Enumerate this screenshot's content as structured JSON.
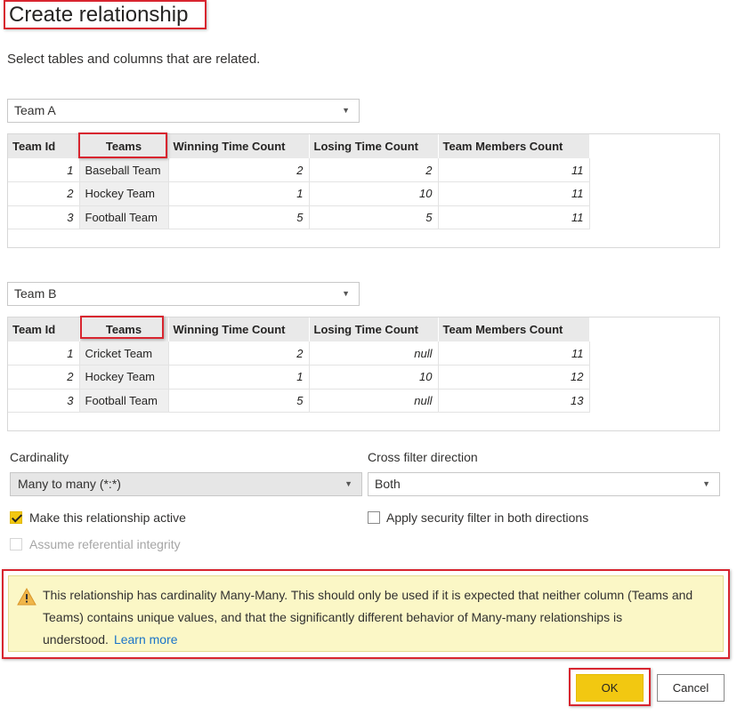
{
  "dialog": {
    "title": "Create relationship",
    "subtitle": "Select tables and columns that are related."
  },
  "table_a": {
    "select_value": "Team A",
    "columns": [
      "Team Id",
      "Teams",
      "Winning Time Count",
      "Losing Time Count",
      "Team Members Count"
    ],
    "rows": [
      [
        "1",
        "Baseball Team",
        "2",
        "2",
        "11"
      ],
      [
        "2",
        "Hockey Team",
        "1",
        "10",
        "11"
      ],
      [
        "3",
        "Football Team",
        "5",
        "5",
        "11"
      ]
    ]
  },
  "table_b": {
    "select_value": "Team B",
    "columns": [
      "Team Id",
      "Teams",
      "Winning Time Count",
      "Losing Time Count",
      "Team Members Count"
    ],
    "rows": [
      [
        "1",
        "Cricket Team",
        "2",
        "null",
        "11"
      ],
      [
        "2",
        "Hockey Team",
        "1",
        "10",
        "12"
      ],
      [
        "3",
        "Football Team",
        "5",
        "null",
        "13"
      ]
    ]
  },
  "cardinality": {
    "label": "Cardinality",
    "value": "Many to many (*:*)"
  },
  "cross_filter": {
    "label": "Cross filter direction",
    "value": "Both"
  },
  "options": {
    "active": {
      "label": "Make this relationship active",
      "checked": true
    },
    "security": {
      "label": "Apply security filter in both directions",
      "checked": false
    },
    "integrity": {
      "label": "Assume referential integrity",
      "checked": false,
      "disabled": true
    }
  },
  "warning": {
    "text": "This relationship has cardinality Many-Many. This should only be used if it is expected that neither column (Teams and Teams) contains unique values, and that the significantly different behavior of Many-many relationships is understood.",
    "link": "Learn more"
  },
  "buttons": {
    "ok": "OK",
    "cancel": "Cancel"
  },
  "colors": {
    "accent": "#f2c811",
    "highlight_border": "#d8252f",
    "warning_bg": "#fbf7c6",
    "link": "#1a73c8"
  },
  "icons": {
    "dropdown": "chevron-down-icon",
    "warning": "warning-icon",
    "check": "checkmark-icon"
  }
}
